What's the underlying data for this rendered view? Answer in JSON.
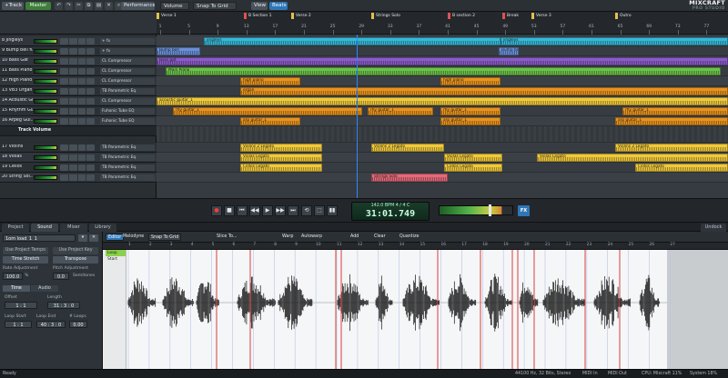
{
  "toolbar": {
    "track_btn": "+Track",
    "master_btn": "Master",
    "volume_select": "Volume",
    "snap_select": "Snap To Grid",
    "view_btn": "View",
    "beats_btn": "Beats",
    "performance_btn": "Performance"
  },
  "logo": {
    "line1": "MIXCRAFT",
    "line2": "PRO STUDIO"
  },
  "markers": [
    {
      "label": "Verse 1",
      "color": "#e4c04c"
    },
    {
      "label": "B Section 1",
      "color": "#e05050"
    },
    {
      "label": "Verse 2",
      "color": "#e4c04c"
    },
    {
      "label": "Strings Solo",
      "color": "#e4c04c"
    },
    {
      "label": "B section 2",
      "color": "#e05050"
    },
    {
      "label": "Break",
      "color": "#e05050"
    },
    {
      "label": "Verse 3",
      "color": "#e4c04c"
    },
    {
      "label": "Outro",
      "color": "#e4c04c"
    }
  ],
  "ruler_bars": [
    "1",
    "5",
    "9",
    "13",
    "17",
    "21",
    "25",
    "29",
    "33",
    "37",
    "41",
    "45",
    "49",
    "53",
    "57",
    "61",
    "65",
    "69",
    "73",
    "77"
  ],
  "tracks": [
    {
      "name": "8 Jingleys",
      "fx": "+ fx"
    },
    {
      "name": "9 Bump bell fu..",
      "fx": "+ fx"
    },
    {
      "name": "10 Bass Gat",
      "fx": "CL Compressor"
    },
    {
      "name": "11 Bass Piano",
      "fx": "CL Compressor"
    },
    {
      "name": "12 High Piano",
      "fx": "CL Compressor"
    },
    {
      "name": "13 VB3 Organ",
      "fx": "TB Parametric Eq."
    },
    {
      "name": "14 Acoustic Gui..",
      "fx": "CL Compressor"
    },
    {
      "name": "15 Rhythm Gui..",
      "fx": "Fuhonic Tube EQ"
    },
    {
      "name": "16 Arpeg Gui..",
      "fx": "Fuhonic Tube EQ"
    },
    {
      "name": "17 Violins",
      "fx": "TB Parametric Eq."
    },
    {
      "name": "18 Violas",
      "fx": "TB Parametric Eq."
    },
    {
      "name": "19 Cellos",
      "fx": "TB Parametric Eq."
    },
    {
      "name": "20 String Sol..",
      "fx": "TB Parametric Eq."
    }
  ],
  "automation_label": "Track Volume",
  "clips": {
    "jingleys": "jingleys",
    "bump_bell": "Bump bell",
    "bass_gat": "Bass gat",
    "bass_piano": "Main Piano",
    "high_piano": "high piano",
    "organ": "organ",
    "acoustic": "acoustic guitar_1",
    "rhythm": "rhy guitar_1",
    "arpeg": "arp guitar_1",
    "violins": "Violins 2 Legato",
    "violas": "Violas Legato",
    "cellos": "Cellos Legato",
    "strings_solo": "Strings Solo"
  },
  "transport": {
    "lcd_top": "142.0 BPM   4 / 4   C",
    "lcd_time": "31:01.749",
    "fx_label": "FX",
    "buttons": [
      "●",
      "■",
      "⏮",
      "◀◀",
      "▶",
      "▶▶",
      "⏭",
      "⟲",
      "⬚",
      "▮▮"
    ]
  },
  "bottom_tabs": [
    "Project",
    "Sound",
    "Mixer",
    "Library"
  ],
  "undock_label": "Undock",
  "soundpanel": {
    "file": "1om load_1_1",
    "btn_project_tempo": "Use Project Tempo",
    "btn_project_key": "Use Project Key",
    "btn_time_stretch": "Time Stretch",
    "btn_transpose": "Transpose",
    "rate_label": "Rate Adjustment",
    "rate_value": "100.0",
    "pitch_label": "Pitch Adjustment",
    "pitch_value": "0.0",
    "semitones": "Semitones",
    "tab_time": "Time",
    "tab_audio": "Audio",
    "offset_label": "Offset",
    "offset_value": "1 : 1",
    "length_label": "Length",
    "length_value": "31 : 3 : 0",
    "loop_start_label": "Loop Start",
    "loop_start_value": "1 : 1",
    "loop_end_label": "Loop End",
    "loop_end_value": "40 : 3 : 0",
    "loops_label": "# Loops",
    "loops_value": "0.00"
  },
  "editor": {
    "editor_tab": "Editor",
    "melodyne": "Melodyne",
    "snap": "Snap To Grid",
    "slice": "Slice To...",
    "warp": "Warp",
    "autowarp": "Autowarp",
    "add": "Add",
    "clear": "Clear",
    "quantize": "Quantize",
    "loop_start": "Loop Start",
    "bars": [
      "1",
      "2",
      "3",
      "4",
      "5",
      "6",
      "7",
      "8",
      "9",
      "10",
      "11",
      "12",
      "13",
      "14",
      "15",
      "16",
      "17",
      "18",
      "19",
      "20",
      "21",
      "22",
      "23",
      "24",
      "25",
      "26",
      "27"
    ]
  },
  "status": {
    "ready": "Ready",
    "format": "44100 Hz, 32 Bits, Stereo",
    "midi_in": "MIDI In",
    "midi_out": "MIDI Out",
    "cpu": "CPU: Mixcraft 11%",
    "system": "System 18%"
  },
  "colors": {
    "cyan": "#37b8d8",
    "blue": "#6a8fd8",
    "purple": "#8a5cc8",
    "green": "#6cc24a",
    "orange": "#e8931e",
    "yellow": "#f0c93c",
    "pink": "#e56a7a",
    "playhead": "#2f86ff"
  }
}
